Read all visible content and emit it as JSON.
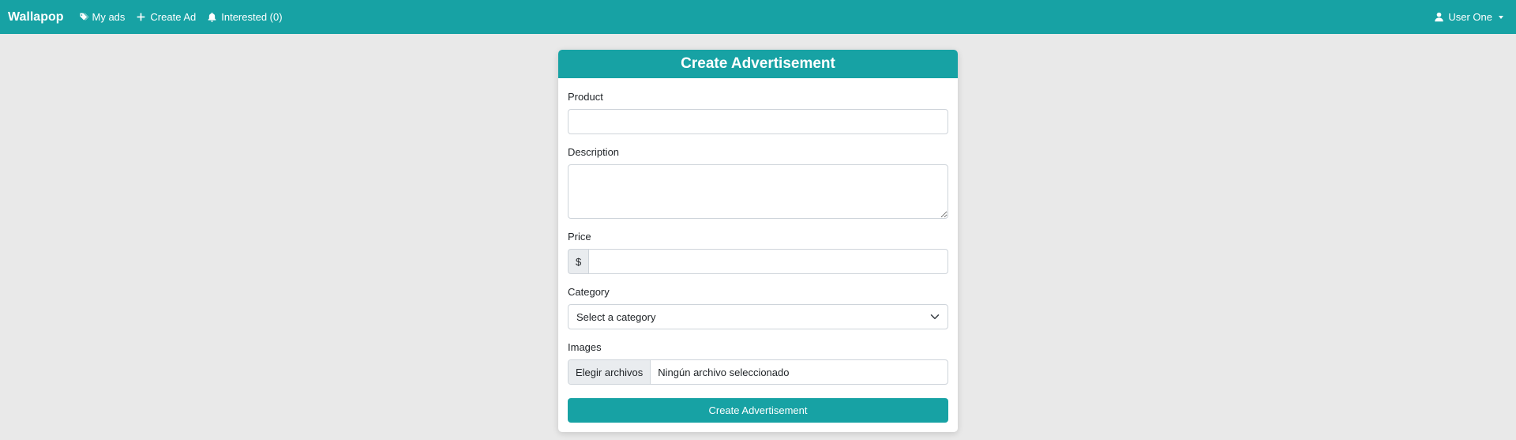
{
  "navbar": {
    "brand": "Wallapop",
    "my_ads": "My ads",
    "create_ad": "Create Ad",
    "interested": "Interested (0)",
    "user": "User One",
    "color": "#17a2a4"
  },
  "form": {
    "title": "Create Advertisement",
    "product_label": "Product",
    "product_value": "",
    "description_label": "Description",
    "description_value": "",
    "price_label": "Price",
    "price_prefix": "$",
    "price_value": "",
    "category_label": "Category",
    "category_selected": "Select a category",
    "images_label": "Images",
    "file_button": "Elegir archivos",
    "file_status": "Ningún archivo seleccionado",
    "submit_label": "Create Advertisement"
  },
  "icons": {
    "my_ads": "tags-icon",
    "create_ad": "plus-icon",
    "interested": "bell-icon",
    "user": "user-icon",
    "user_menu": "caret-down-icon",
    "category": "chevron-down-icon"
  }
}
